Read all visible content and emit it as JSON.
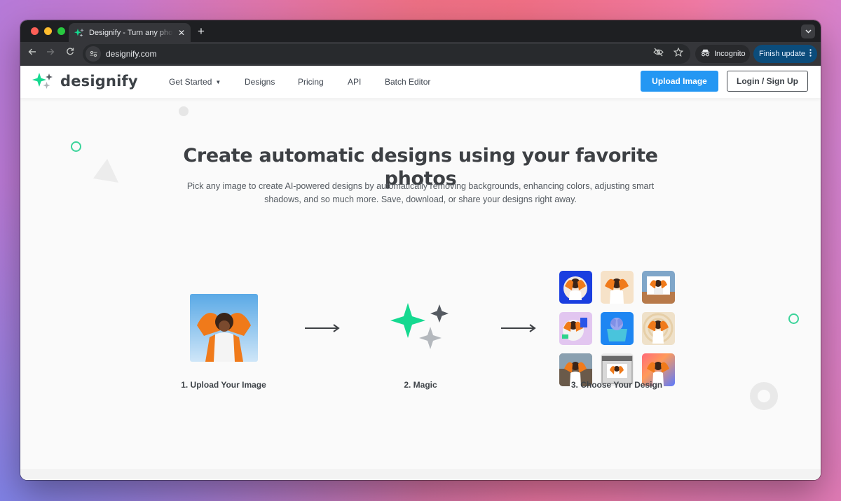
{
  "browser": {
    "tab_title": "Designify - Turn any photo into a design",
    "tab_close": "✕",
    "new_tab": "+",
    "url": "designify.com",
    "incognito_label": "Incognito",
    "update_label": "Finish update"
  },
  "nav": {
    "logo_text": "designify",
    "items": [
      "Get Started",
      "Designs",
      "Pricing",
      "API",
      "Batch Editor"
    ],
    "upload_button": "Upload Image",
    "login_button": "Login / Sign Up"
  },
  "hero": {
    "title_line1": "Create automatic designs using your favorite",
    "title_line2": "photos",
    "subtitle_line1": "Pick any image to create AI-powered designs by automatically removing backgrounds, enhancing colors, adjusting smart",
    "subtitle_line2": "shadows, and so much more. Save, download, or share your designs right away."
  },
  "steps": [
    {
      "label": "1. Upload Your Image"
    },
    {
      "label": "2. Magic"
    },
    {
      "label": "3. Choose Your Design"
    }
  ],
  "colors": {
    "accent": "#2497f3",
    "brand_green": "#15d990",
    "brand_gray": "#555a61"
  }
}
